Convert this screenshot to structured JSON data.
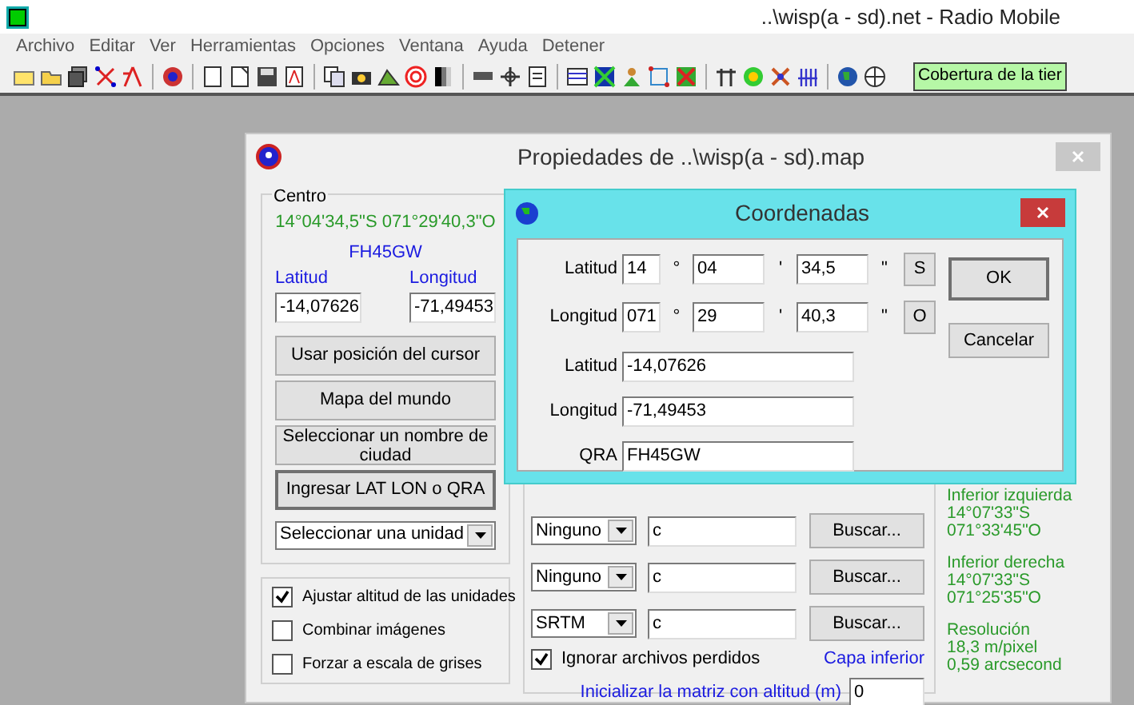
{
  "window": {
    "title": "..\\wisp(a - sd).net - Radio Mobile"
  },
  "menu": [
    "Archivo",
    "Editar",
    "Ver",
    "Herramientas",
    "Opciones",
    "Ventana",
    "Ayuda",
    "Detener"
  ],
  "toolbar": {
    "status": "Cobertura de la tier"
  },
  "properties_dialog": {
    "title": "Propiedades de ..\\wisp(a - sd).map",
    "center": {
      "legend": "Centro",
      "coords": "14°04'34,5\"S 071°29'40,3\"O",
      "qra": "FH45GW",
      "lat_label": "Latitud",
      "lat_value": "-14,07626",
      "lon_label": "Longitud",
      "lon_value": "-71,49453"
    },
    "buttons": [
      {
        "label": "Usar posición del cursor",
        "default": false
      },
      {
        "label": "Mapa del mundo",
        "default": false
      },
      {
        "label": "Seleccionar un nombre de ciudad",
        "default": false
      },
      {
        "label": "Ingresar LAT LON o QRA",
        "default": true
      }
    ],
    "unit_select": "Seleccionar una unidad",
    "options": [
      {
        "label": "Ajustar altitud de las unidades",
        "checked": true
      },
      {
        "label": "Combinar imágenes",
        "checked": false
      },
      {
        "label": "Forzar a escala de grises",
        "checked": false
      }
    ],
    "layers": [
      {
        "source": "Ninguno",
        "path": "c",
        "button": "Buscar..."
      },
      {
        "source": "Ninguno",
        "path": "c",
        "button": "Buscar..."
      },
      {
        "source": "SRTM",
        "path": "c",
        "button": "Buscar..."
      }
    ],
    "ignore_missing": {
      "label": "Ignorar archivos perdidos",
      "checked": true
    },
    "layer_caption": "Capa inferior",
    "init_label": "Inicializar la matriz con altitud (m)",
    "init_value": "0",
    "info": [
      {
        "title": "Inferior izquierda",
        "lines": [
          "14°07'33\"S",
          "071°33'45\"O"
        ]
      },
      {
        "title": "Inferior derecha",
        "lines": [
          "14°07'33\"S",
          "071°25'35\"O"
        ]
      },
      {
        "title": "Resolución",
        "lines": [
          "18,3 m/pixel",
          "0,59 arcsecond"
        ]
      }
    ]
  },
  "coord_dialog": {
    "title": "Coordenadas",
    "dms": [
      {
        "label": "Latitud",
        "deg": "14",
        "min": "04",
        "sec": "34,5",
        "hemisphere": "S"
      },
      {
        "label": "Longitud",
        "deg": "071",
        "min": "29",
        "sec": "40,3",
        "hemisphere": "O"
      }
    ],
    "marks": [
      "°",
      "'",
      "\""
    ],
    "decimal": [
      {
        "label": "Latitud",
        "value": "-14,07626"
      },
      {
        "label": "Longitud",
        "value": "-71,49453"
      },
      {
        "label": "QRA",
        "value": "FH45GW"
      }
    ],
    "buttons": [
      {
        "label": "OK",
        "default": true
      },
      {
        "label": "Cancelar",
        "default": false
      }
    ]
  }
}
